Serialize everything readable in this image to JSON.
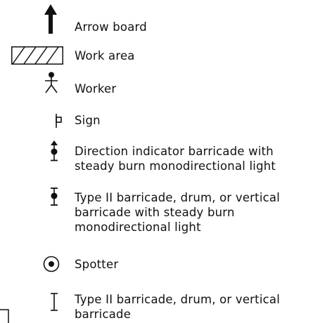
{
  "legend": {
    "items": [
      {
        "icon": "arrow-board-icon",
        "label": "Arrow board"
      },
      {
        "icon": "work-area-hatch-icon",
        "label": "Work area"
      },
      {
        "icon": "worker-icon",
        "label": "Worker"
      },
      {
        "icon": "sign-icon",
        "label": "Sign"
      },
      {
        "icon": "direction-indicator-barricade-icon",
        "label": "Direction indicator barricade with\nsteady burn monodirectional light"
      },
      {
        "icon": "type-ii-barricade-light-icon",
        "label": "Type II barricade, drum, or vertical\nbarricade with steady burn\nmonodirectional light"
      },
      {
        "icon": "spotter-icon",
        "label": "Spotter"
      },
      {
        "icon": "type-ii-barricade-icon",
        "label": "Type II barricade, drum, or vertical\nbarricade"
      }
    ]
  },
  "colors": {
    "ink": "#111111",
    "background": "#ffffff"
  }
}
